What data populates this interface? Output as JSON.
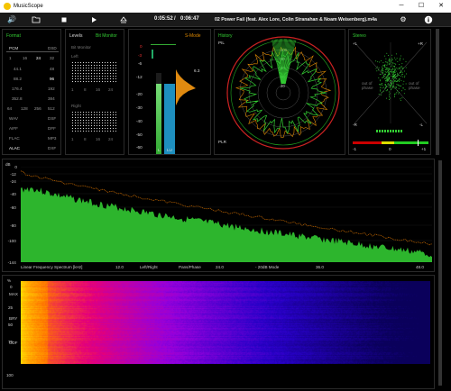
{
  "window": {
    "title": "MusicScope",
    "minimize": "─",
    "maximize": "☐",
    "close": "✕"
  },
  "toolbar": {
    "position": "0:05:52",
    "separator": "/",
    "duration": "0:06:47",
    "track": "02 Power Fail (feat. Alex Lore, Colin Stranahan & Noam Weisenberg).m4a",
    "icons": [
      "volume-icon",
      "folder-icon",
      "stop-icon",
      "play-icon",
      "eject-icon",
      "settings-icon",
      "info-icon"
    ]
  },
  "format": {
    "title": "Format",
    "row1": [
      "PCM",
      "DSD"
    ],
    "row2": [
      "1",
      "16",
      "24",
      "32"
    ],
    "rates": [
      [
        "44.1",
        "48"
      ],
      [
        "88.2",
        "96"
      ],
      [
        "176.4",
        "192"
      ],
      [
        "352.8",
        "384"
      ]
    ],
    "dsd": [
      "64",
      "128",
      "256",
      "512"
    ],
    "containers": [
      [
        "WAV",
        "DSF"
      ],
      [
        "AIFF",
        "DFF"
      ],
      [
        "FLAC",
        "MP3"
      ],
      [
        "ALAC",
        "DXF"
      ]
    ]
  },
  "levels": {
    "title": "Levels",
    "mode": "Bit Monitor",
    "bit_monitor": "Bit Monitor",
    "left": "Left",
    "right": "Right",
    "left_markers": [
      "1",
      "8",
      "16",
      "24"
    ],
    "right_markers": [
      "1",
      "8",
      "16",
      "24"
    ]
  },
  "meter": {
    "title": "S-Mode",
    "scale": [
      "0",
      "-3",
      "-6",
      "-12",
      "-20",
      "-30",
      "-40",
      "-50",
      "-60"
    ],
    "peak_value": "6.3",
    "channel_labels": [
      "L",
      "LU"
    ]
  },
  "history": {
    "title": "History",
    "top_label": "PIL",
    "bottom_label": "PLR",
    "rings": [
      "20",
      "40",
      "60",
      "80",
      "100"
    ]
  },
  "stereo": {
    "title": "Stereo",
    "plus_l": "+L",
    "plus_r": "+R",
    "minus_r": "-R",
    "minus_l": "-L",
    "out_of_phase": "out of phase",
    "corr_min": "-1",
    "corr_zero": "0",
    "corr_max": "+1"
  },
  "spectrum": {
    "db_label": "dB",
    "y_ticks": [
      "0",
      "-12",
      "-24",
      "-40",
      "-60",
      "-80",
      "-100",
      "-144"
    ],
    "x_ticks": [
      "12.0",
      "24.0",
      "36.0",
      "48.0"
    ],
    "mode_label": "Linear Frequency Spectrum [kHz]",
    "options": [
      "Left/Right",
      "Pans/Phase",
      "- 20dB Mode"
    ]
  },
  "spectrogram": {
    "y_unit": "%",
    "y_ticks": [
      "0",
      "25",
      "50",
      "75",
      "100"
    ],
    "markers": [
      "MAX",
      "BRY",
      "CDF"
    ]
  },
  "colors": {
    "accent_green": "#33cc33",
    "accent_orange": "#dd8800",
    "meter_blue": "#1e8fbf",
    "history_red": "#cc2222"
  }
}
